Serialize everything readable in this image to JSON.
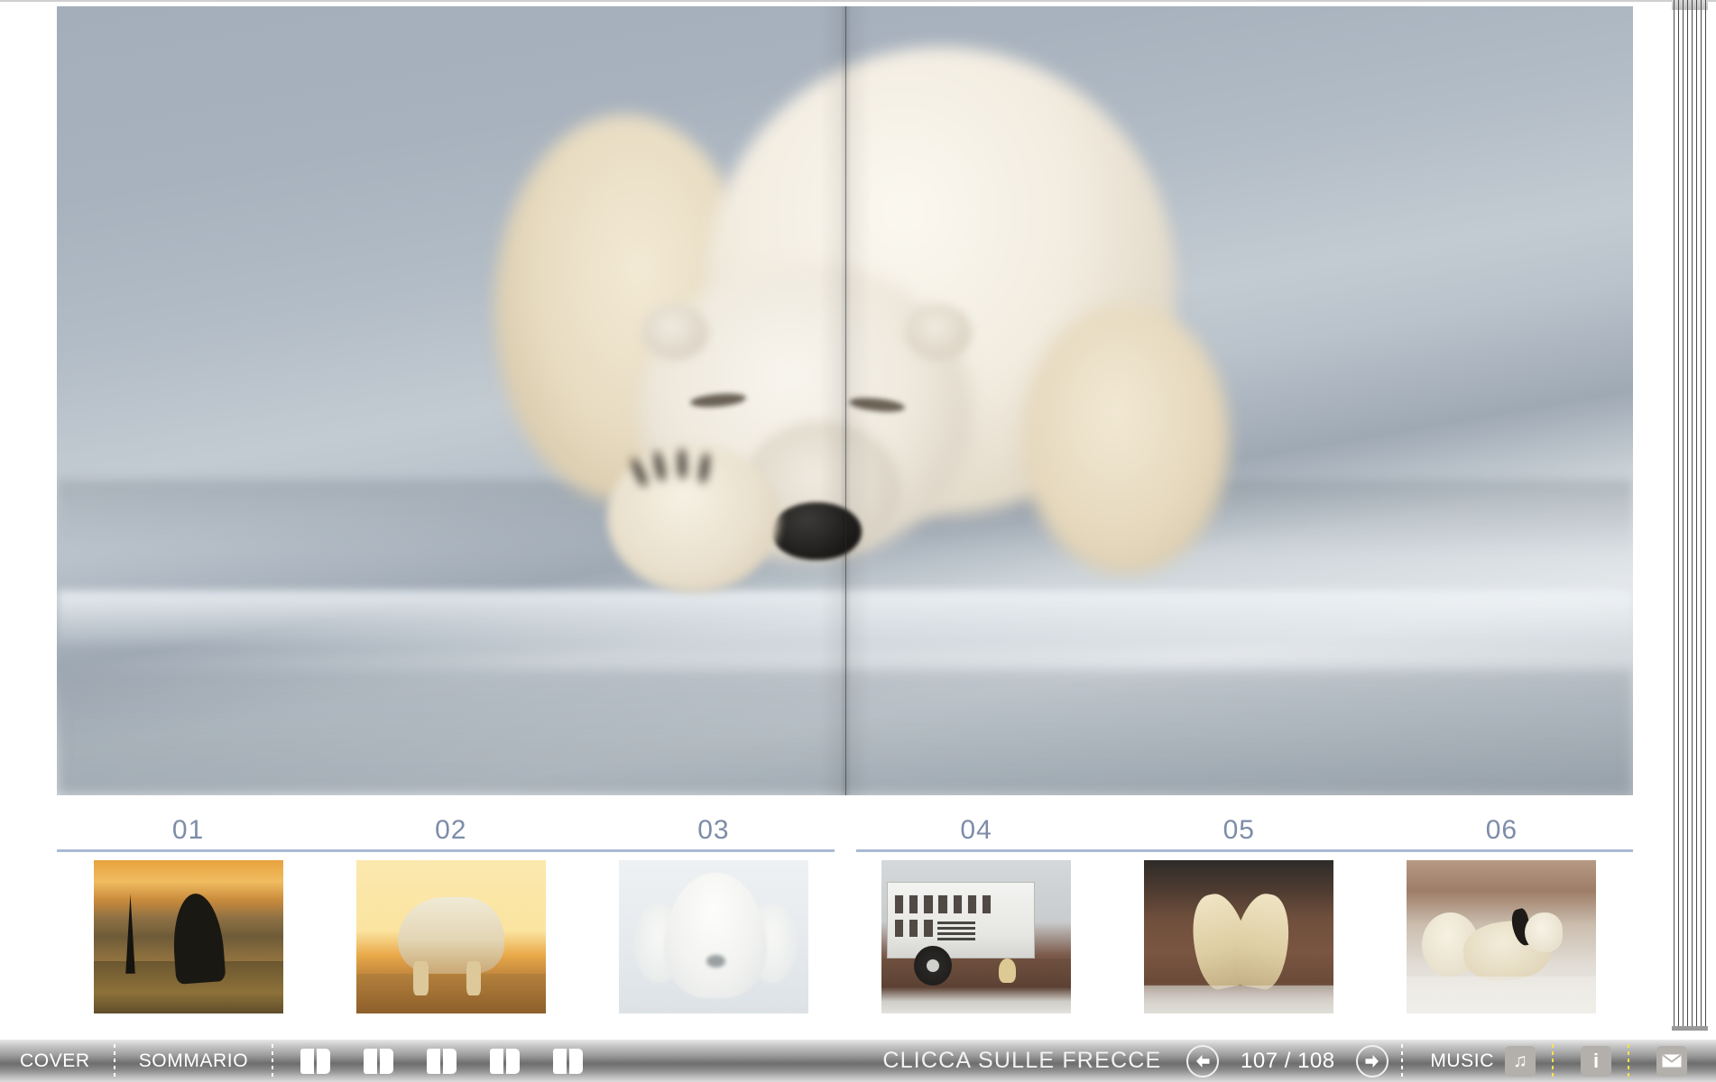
{
  "viewer": {
    "title": "Flipbook page viewer"
  },
  "spread": {
    "hero": {
      "alt": "Sleeping polar bear resting on ice",
      "caption": ""
    },
    "index_numbers": [
      "01",
      "02",
      "03",
      "04",
      "05",
      "06"
    ],
    "thumbnails": [
      {
        "number": "01",
        "alt": "Polar bear silhouette at golden sunset on the tundra"
      },
      {
        "number": "02",
        "alt": "Polar bear walking in warm golden backlight"
      },
      {
        "number": "03",
        "alt": "White polar bear sleeping curled on ice"
      },
      {
        "number": "04",
        "alt": "Tundra Buggy vehicle with a polar bear cub beside it"
      },
      {
        "number": "05",
        "alt": "Two polar bears sparring on snowy tundra"
      },
      {
        "number": "06",
        "alt": "Polar bear rolling on its back in the snow"
      }
    ]
  },
  "toolbar": {
    "cover_label": "COVER",
    "summary_label": "SOMMARIO",
    "spread_icon_count": 5,
    "spread_icon_name": "page-spread-icon",
    "hint_text": "CLICCA SULLE FRECCE",
    "prev_icon": "arrow-left-icon",
    "next_icon": "arrow-right-icon",
    "page_indicator": "107 / 108",
    "current_page": "107",
    "total_pages": "108",
    "music_label": "MUSIC",
    "music_icon": "music-note-icon",
    "info_icon": "info-icon",
    "mail_icon": "mail-icon",
    "separator_color": "#ffffff",
    "accent_separator_color": "#ffe14d"
  },
  "colors": {
    "index_number": "#7d8da8",
    "index_rule": "#a9bad2",
    "toolbar_text": "#ffffff",
    "toolbar_button": "#b3b0ab"
  }
}
